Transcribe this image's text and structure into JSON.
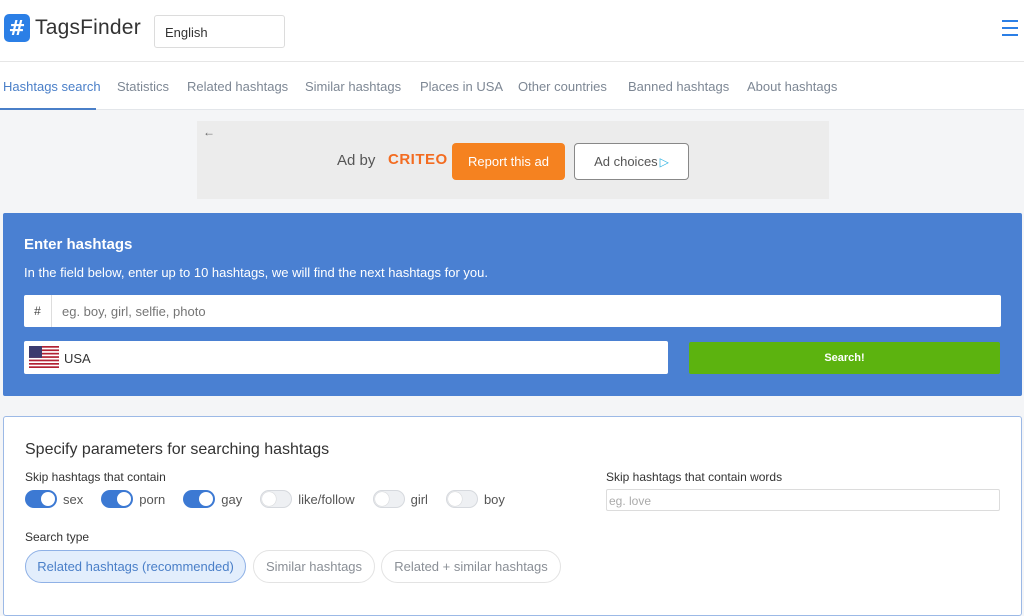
{
  "app": {
    "logo_glyph": "#",
    "name": "TagsFinder",
    "language": "English",
    "brand_color": "#2b7fe6"
  },
  "nav": {
    "tabs": [
      {
        "label": "Hashtags search",
        "active": true
      },
      {
        "label": "Statistics"
      },
      {
        "label": "Related hashtags"
      },
      {
        "label": "Similar hashtags"
      },
      {
        "label": "Places in USA"
      },
      {
        "label": "Other countries"
      },
      {
        "label": "Banned hashtags"
      },
      {
        "label": "About hashtags"
      }
    ]
  },
  "ad": {
    "back_glyph": "←",
    "ad_by": "Ad by",
    "brand": "CRITEO",
    "report_label": "Report this ad",
    "choices_label": "Ad choices",
    "choices_icon": "▷"
  },
  "search": {
    "title": "Enter hashtags",
    "description": "In the field below, enter up to 10 hashtags, we will find the next hashtags for you.",
    "prefix": "#",
    "placeholder": "eg. boy, girl, selfie, photo",
    "country": "USA",
    "button_label": "Search!",
    "panel_color": "#4a80d2",
    "button_color": "#5cb30f"
  },
  "params": {
    "title": "Specify parameters for searching hashtags",
    "skip_label": "Skip hashtags that contain",
    "toggles": [
      {
        "label": "sex",
        "on": true
      },
      {
        "label": "porn",
        "on": true
      },
      {
        "label": "gay",
        "on": true
      },
      {
        "label": "like/follow",
        "on": false
      },
      {
        "label": "girl",
        "on": false
      },
      {
        "label": "boy",
        "on": false
      }
    ],
    "skip_words_label": "Skip hashtags that contain words",
    "skip_words_placeholder": "eg. love",
    "search_type_label": "Search type",
    "search_types": [
      {
        "label": "Related hashtags (recommended)",
        "active": true
      },
      {
        "label": "Similar hashtags",
        "active": false
      },
      {
        "label": "Related + similar hashtags",
        "active": false
      }
    ]
  }
}
